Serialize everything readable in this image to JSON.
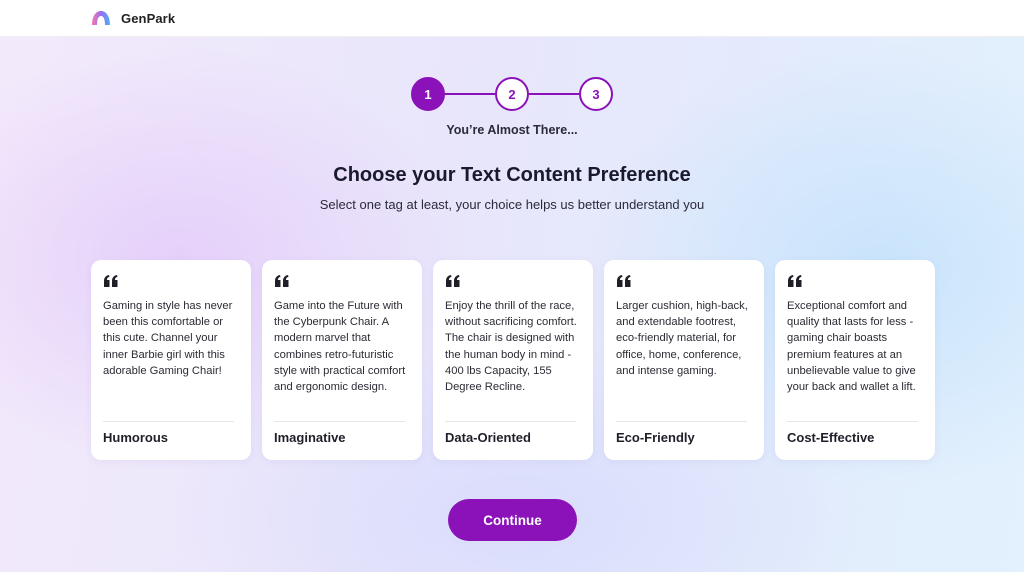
{
  "app": {
    "name": "GenPark",
    "colors": {
      "accent": "#8a12b8",
      "card_bg": "#ffffff"
    }
  },
  "stepper": {
    "steps": [
      "1",
      "2",
      "3"
    ],
    "current_step": 1,
    "status": "You’re Almost There..."
  },
  "main": {
    "title": "Choose your Text Content Preference",
    "subtitle": "Select one tag at least, your choice helps us better understand you"
  },
  "cards": [
    {
      "icon": "quote-icon",
      "text": "Gaming in style has never been this comfortable or this cute. Channel your inner Barbie girl with this adorable Gaming Chair!",
      "tag": "Humorous"
    },
    {
      "icon": "quote-icon",
      "text": "Game into the Future with the Cyberpunk Chair. A modern marvel that combines retro-futuristic style with practical comfort and ergonomic design.",
      "tag": "Imaginative"
    },
    {
      "icon": "quote-icon",
      "text": "Enjoy the thrill of the race, without sacrificing comfort. The chair is designed with the human body in mind - 400 lbs Capacity, 155 Degree Recline.",
      "tag": "Data-Oriented"
    },
    {
      "icon": "quote-icon",
      "text": "Larger cushion, high-back, and extendable footrest, eco-friendly material, for office, home, conference, and intense gaming.",
      "tag": "Eco-Friendly"
    },
    {
      "icon": "quote-icon",
      "text": "Exceptional comfort and quality that lasts for less - gaming chair boasts premium features at an unbelievable value to give your back and wallet a lift.",
      "tag": "Cost-Effective"
    }
  ],
  "actions": {
    "continue_label": "Continue"
  }
}
